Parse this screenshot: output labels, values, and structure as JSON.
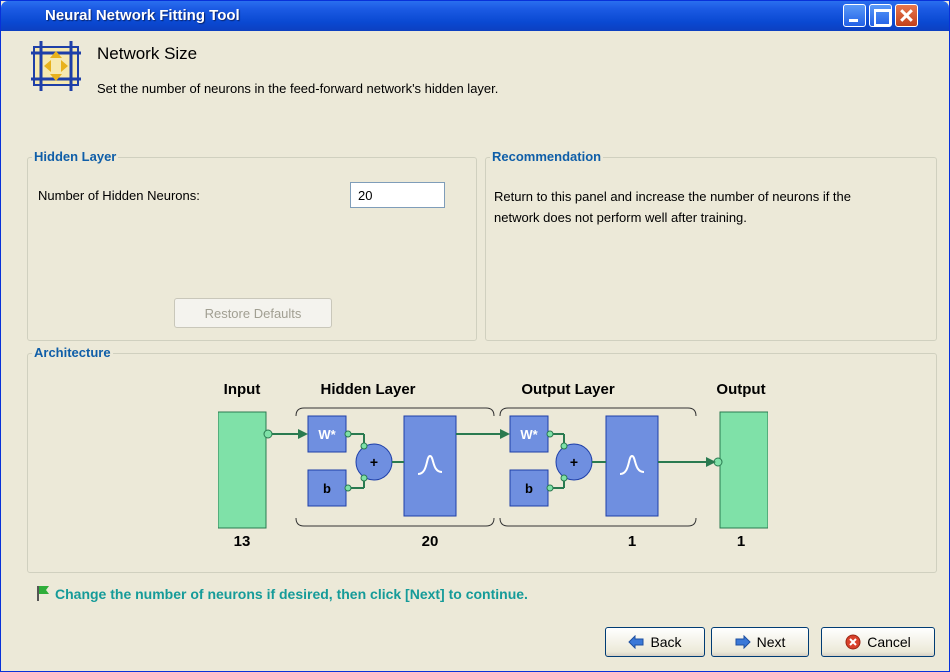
{
  "window": {
    "title": "Neural Network Fitting Tool"
  },
  "header": {
    "title": "Network Size",
    "subtitle": "Set the number of neurons in the feed-forward network's hidden layer."
  },
  "hidden_layer": {
    "legend": "Hidden Layer",
    "label": "Number of Hidden Neurons:",
    "value": "20",
    "restore_button": "Restore Defaults"
  },
  "recommendation": {
    "legend": "Recommendation",
    "text": "Return to this panel and increase the number of neurons if the network does not perform well after training."
  },
  "architecture": {
    "legend": "Architecture",
    "input_title": "Input",
    "hidden_title": "Hidden Layer",
    "output_layer_title": "Output Layer",
    "output_title": "Output",
    "weight_label": "W*",
    "bias_label": "b",
    "sum_label": "+",
    "input_count": "13",
    "hidden_count": "20",
    "output_layer_count": "1",
    "output_count": "1"
  },
  "hint": "Change the number of neurons if desired, then click [Next] to continue.",
  "buttons": {
    "back": "Back",
    "next": "Next",
    "cancel": "Cancel"
  },
  "colors": {
    "title_bar": "#0a49d2",
    "legend": "#0f5ea8",
    "hint": "#159b99",
    "layer_block": "#6f8fe0",
    "io_block": "#7fe1a8"
  }
}
